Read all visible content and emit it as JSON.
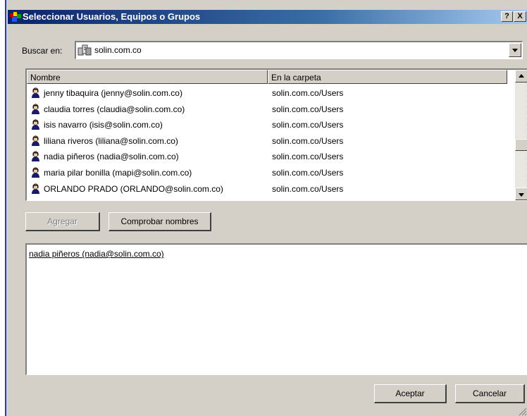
{
  "window": {
    "title": "Seleccionar Usuarios, Equipos o Grupos",
    "help_glyph": "?",
    "close_glyph": "X"
  },
  "icons": {
    "title": "users-app-icon",
    "domain": "domain-icon",
    "user": "user-icon"
  },
  "buscar": {
    "label": "Buscar en:",
    "value": "solin.com.co"
  },
  "list": {
    "columns": [
      "Nombre",
      "En la carpeta"
    ],
    "rows": [
      [
        "jenny tibaquira (jenny@solin.com.co)",
        "solin.com.co/Users"
      ],
      [
        "claudia torres (claudia@solin.com.co)",
        "solin.com.co/Users"
      ],
      [
        "isis navarro (isis@solin.com.co)",
        "solin.com.co/Users"
      ],
      [
        "liliana riveros (liliana@solin.com.co)",
        "solin.com.co/Users"
      ],
      [
        "nadia piñeros (nadia@solin.com.co)",
        "solin.com.co/Users"
      ],
      [
        "maria pilar bonilla (mapi@solin.com.co)",
        "solin.com.co/Users"
      ],
      [
        "ORLANDO PRADO (ORLANDO@solin.com.co)",
        "solin.com.co/Users"
      ]
    ]
  },
  "buttons": {
    "agregar": "Agregar",
    "comprobar": "Comprobar nombres",
    "aceptar": "Aceptar",
    "cancelar": "Cancelar"
  },
  "selected": {
    "entry": "nadia piñeros (nadia@solin.com.co)"
  },
  "colors": {
    "face": "#d4d0c8",
    "title_start": "#0a246a",
    "title_end": "#a6caf0"
  }
}
